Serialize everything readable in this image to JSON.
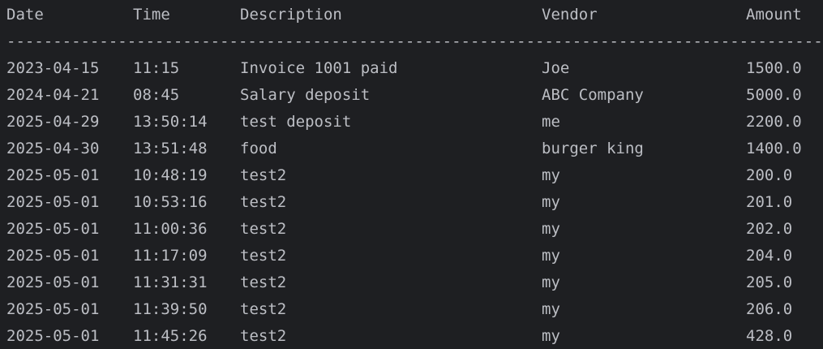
{
  "header": {
    "date": "Date",
    "time": "Time",
    "description": "Description",
    "vendor": "Vendor",
    "amount": "Amount"
  },
  "separator": "------------------------------------------------------------------------------------------",
  "rows": [
    {
      "date": "2023-04-15",
      "time": "11:15",
      "description": "Invoice 1001 paid",
      "vendor": "Joe",
      "amount": "1500.0"
    },
    {
      "date": "2024-04-21",
      "time": "08:45",
      "description": "Salary deposit",
      "vendor": "ABC Company",
      "amount": "5000.0"
    },
    {
      "date": "2025-04-29",
      "time": "13:50:14",
      "description": "test deposit",
      "vendor": "me",
      "amount": "2200.0"
    },
    {
      "date": "2025-04-30",
      "time": "13:51:48",
      "description": "food",
      "vendor": "burger king",
      "amount": "1400.0"
    },
    {
      "date": "2025-05-01",
      "time": "10:48:19",
      "description": "test2",
      "vendor": "my",
      "amount": "200.0"
    },
    {
      "date": "2025-05-01",
      "time": "10:53:16",
      "description": "test2",
      "vendor": "my",
      "amount": "201.0"
    },
    {
      "date": "2025-05-01",
      "time": "11:00:36",
      "description": "test2",
      "vendor": "my",
      "amount": "202.0"
    },
    {
      "date": "2025-05-01",
      "time": "11:17:09",
      "description": "test2",
      "vendor": "my",
      "amount": "204.0"
    },
    {
      "date": "2025-05-01",
      "time": "11:31:31",
      "description": "test2",
      "vendor": "my",
      "amount": "205.0"
    },
    {
      "date": "2025-05-01",
      "time": "11:39:50",
      "description": "test2",
      "vendor": "my",
      "amount": "206.0"
    },
    {
      "date": "2025-05-01",
      "time": "11:45:26",
      "description": "test2",
      "vendor": "my",
      "amount": "428.0"
    }
  ]
}
